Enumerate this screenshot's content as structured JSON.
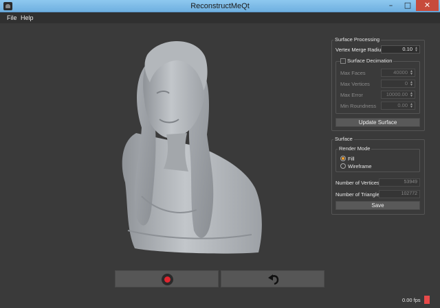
{
  "window": {
    "title": "ReconstructMeQt",
    "icon": "app-icon",
    "controls": {
      "minimize": "–",
      "maximize": "□",
      "close": "✕"
    }
  },
  "menu": [
    {
      "label": "File"
    },
    {
      "label": "Help"
    }
  ],
  "viewport": {
    "content": "3D reconstructed bust model",
    "model_color": "#b8bcc0"
  },
  "controls": {
    "record_icon": "record-icon",
    "record_color": "#e0252f",
    "undo_icon": "undo-icon"
  },
  "surface_processing": {
    "title": "Surface Processing",
    "vertex_merge_radius": {
      "label": "Vertex Merge Radius",
      "value": "0.10"
    },
    "surface_decimation": {
      "title": "Surface Decimation",
      "checked": false,
      "max_faces": {
        "label": "Max Faces",
        "value": "40000"
      },
      "max_vertices": {
        "label": "Max Vertices",
        "value": "0"
      },
      "max_error": {
        "label": "Max Error",
        "value": "10000.00"
      },
      "min_roundness": {
        "label": "Min Roundness",
        "value": "0.00"
      }
    },
    "update_button": "Update Surface"
  },
  "surface": {
    "title": "Surface",
    "render_mode": {
      "title": "Render Mode",
      "options": [
        {
          "label": "Fill",
          "checked": true
        },
        {
          "label": "Wireframe",
          "checked": false
        }
      ]
    },
    "number_of_vertices": {
      "label": "Number of Vertices",
      "value": "53949"
    },
    "number_of_triangles": {
      "label": "Number of Triangles",
      "value": "102772"
    },
    "save_button": "Save"
  },
  "status": {
    "fps": "0.00 fps",
    "indicator_color": "#e84a4a"
  }
}
